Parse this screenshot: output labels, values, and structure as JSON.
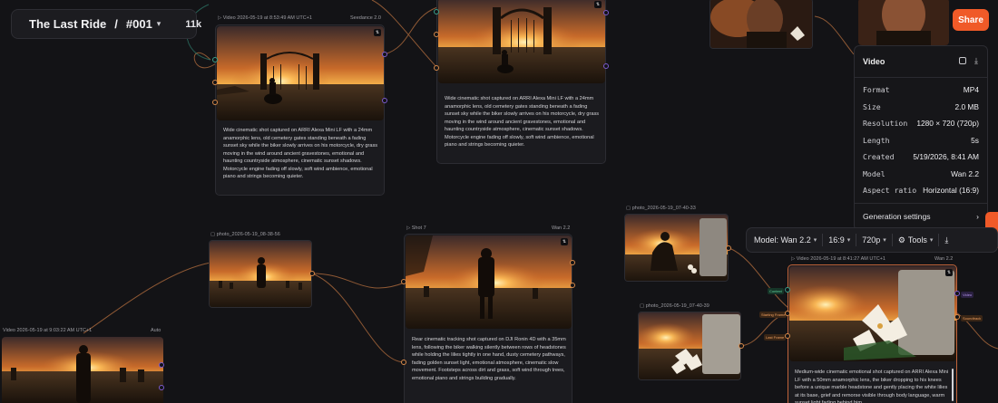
{
  "header": {
    "project_title": "The Last Ride",
    "separator": "/",
    "episode": "#001",
    "member_count": "11k",
    "share_label": "Share"
  },
  "nodes": {
    "n1": {
      "label": "Video 2026-05-19 at 8:53:49 AM UTC+1",
      "model": "Seedance 2.0",
      "text": "Wide cinematic shot captured on ARRI Alexa Mini LF with a 24mm anamorphic lens, old cemetery gates standing beneath a fading sunset sky while the biker slowly arrives on his motorcycle, dry grass moving in the wind around ancient gravestones, emotional and haunting countryside atmosphere, cinematic sunset shadows. Motorcycle engine fading off slowly, soft wind ambience, emotional piano and strings becoming quieter."
    },
    "n2": {
      "text": "Wide cinematic shot captured on ARRI Alexa Mini LF with a 24mm anamorphic lens, old cemetery gates standing beneath a fading sunset sky while the biker slowly arrives on his motorcycle, dry grass moving in the wind around ancient gravestones, emotional and haunting countryside atmosphere, cinematic sunset shadows. Motorcycle engine fading off slowly, soft wind ambience, emotional piano and strings becoming quieter."
    },
    "n3": {
      "label": "photo_2026-05-19_08-38-56"
    },
    "n4": {
      "label": "Shot 7",
      "model": "Wan 2.2",
      "text": "Rear cinematic tracking shot captured on DJI Ronin 4D with a 35mm lens, following the biker walking silently between rows of headstones while holding the lilies tightly in one hand, dusty cemetery pathways, fading golden sunset light, emotional atmosphere, cinematic slow movement. Footsteps across dirt and grass, soft wind through trees, emotional piano and strings building gradually."
    },
    "n5": {
      "label": "Video 2026-05-19 at 9:03:22 AM UTC+1",
      "model": "Auto"
    },
    "n6": {
      "label": "photo_2026-05-19_07-40-33"
    },
    "n7": {
      "label": "photo_2026-05-19_07-40-39"
    },
    "n8": {
      "label": "Video 2026-05-19 at 8:41:27 AM UTC+1",
      "model": "Wan 2.2",
      "text": "Medium-wide cinematic emotional shot captured on ARRI Alexa Mini LF with a 50mm anamorphic lens, the biker dropping to his knees before a unique marble headstone and gently placing the white lilies at its base, grief and remorse visible through body language, warm sunset light fading behind him,",
      "tags": [
        "Context",
        "Starting Frame",
        "Last Frame",
        "Video",
        "Soundtrack"
      ]
    }
  },
  "panel": {
    "title": "Video",
    "rows": [
      {
        "key": "Format",
        "value": "MP4"
      },
      {
        "key": "Size",
        "value": "2.0 MB"
      },
      {
        "key": "Resolution",
        "value": "1280 × 720 (720p)"
      },
      {
        "key": "Length",
        "value": "5s"
      },
      {
        "key": "Created",
        "value": "5/19/2026, 8:41 AM"
      },
      {
        "key": "Model",
        "value": "Wan 2.2"
      },
      {
        "key": "Aspect ratio",
        "value": "Horizontal (16:9)"
      }
    ],
    "generation_settings": "Generation settings"
  },
  "toolbar": {
    "model": "Model: Wan 2.2",
    "aspect": "16:9",
    "resolution": "720p",
    "tools": "Tools"
  },
  "colors": {
    "accent": "#f05a28",
    "edge": "#c27a4a",
    "port_orange": "#d88a4a",
    "port_teal": "#3aa08a",
    "port_violet": "#7d5bd0"
  }
}
